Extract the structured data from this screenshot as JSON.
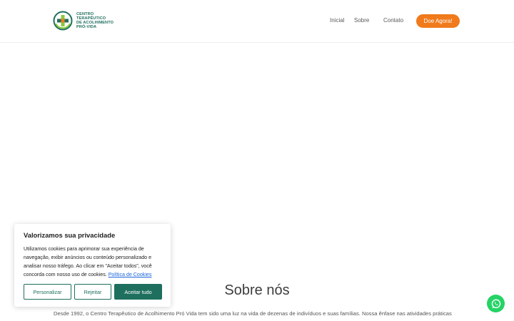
{
  "header": {
    "logo_lines": [
      "CENTRO",
      "TERAPÊUTICO",
      "DE ACOLHIMENTO",
      "PRÓ-VIDA"
    ],
    "nav": [
      {
        "label": "Inicial"
      },
      {
        "label": "Sobre"
      },
      {
        "label": "Contato"
      }
    ],
    "donate_label": "Doe Agora!"
  },
  "colors": {
    "brand_green": "#1f6f5e",
    "accent_orange": "#f07a1c",
    "whatsapp_green": "#25d366"
  },
  "about": {
    "title": "Sobre nós",
    "text": "Desde 1992, o Centro Terapêutico de Acolhimento Pró Vida tem sido uma luz na vida de dezenas de indivíduos e suas famílias. Nossa ênfase nas atividades práticas"
  },
  "cookie_banner": {
    "title": "Valorizamos sua privacidade",
    "body": "Utilizamos cookies para aprimorar sua experiência de navegação, exibir anúncios ou conteúdo personalizado e analisar nosso tráfego. Ao clicar em \"Aceitar todos\", você concorda com nosso uso de cookies.",
    "policy_link": "Política de Cookies",
    "buttons": {
      "customize": "Personalizar",
      "reject": "Rejeitar",
      "accept": "Aceitar tudo"
    }
  },
  "floating": {
    "icon": "whatsapp-icon"
  }
}
